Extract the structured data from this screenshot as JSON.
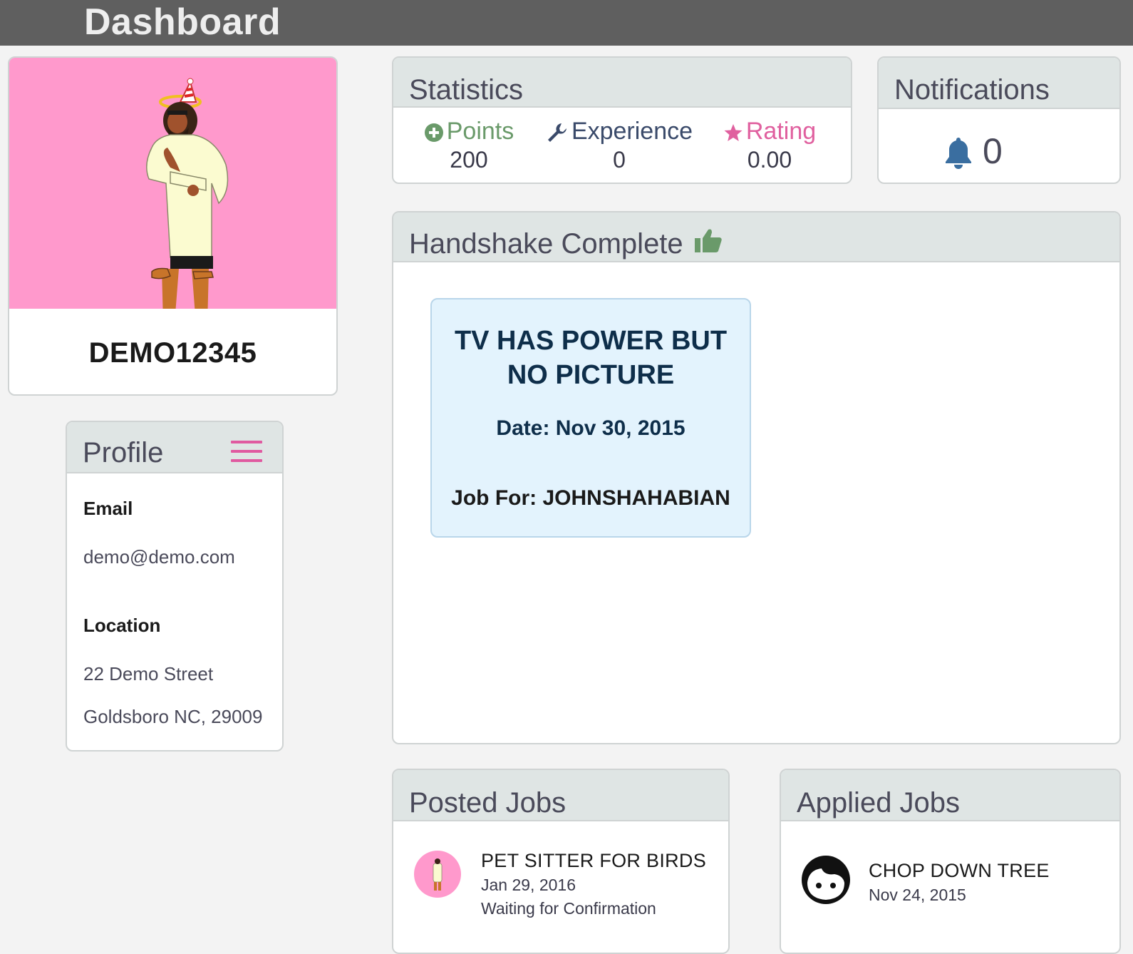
{
  "header": {
    "title": "Dashboard"
  },
  "user": {
    "username": "DEMO12345"
  },
  "profile": {
    "title": "Profile",
    "email_label": "Email",
    "email": "demo@demo.com",
    "location_label": "Location",
    "street": "22 Demo Street",
    "city_state_zip": "Goldsboro NC, 29009",
    "menu_icon": "hamburger-menu-icon"
  },
  "statistics": {
    "title": "Statistics",
    "points_label": "Points",
    "points_value": "200",
    "experience_label": "Experience",
    "experience_value": "0",
    "rating_label": "Rating",
    "rating_value": "0.00"
  },
  "notifications": {
    "title": "Notifications",
    "count": "0",
    "icon": "bell-icon"
  },
  "handshake": {
    "title": "Handshake Complete",
    "job": {
      "title": "TV HAS POWER BUT NO PICTURE",
      "date": "Date: Nov 30, 2015",
      "job_for": "Job For: JOHNSHAHABIAN"
    }
  },
  "posted_jobs": {
    "title": "Posted Jobs",
    "items": [
      {
        "title": "PET SITTER FOR BIRDS",
        "date": "Jan 29, 2016",
        "status": "Waiting for Confirmation"
      }
    ]
  },
  "applied_jobs": {
    "title": "Applied Jobs",
    "items": [
      {
        "title": "CHOP DOWN TREE",
        "date": "Nov 24, 2015"
      }
    ]
  },
  "colors": {
    "topbar": "#5f5f5f",
    "panel_header": "#dfe5e4",
    "avatar_bg": "#ff99cc",
    "points": "#6a9a6a",
    "rating": "#e0609f",
    "bell": "#3a6ea0",
    "job_card": "#e3f3fd"
  }
}
